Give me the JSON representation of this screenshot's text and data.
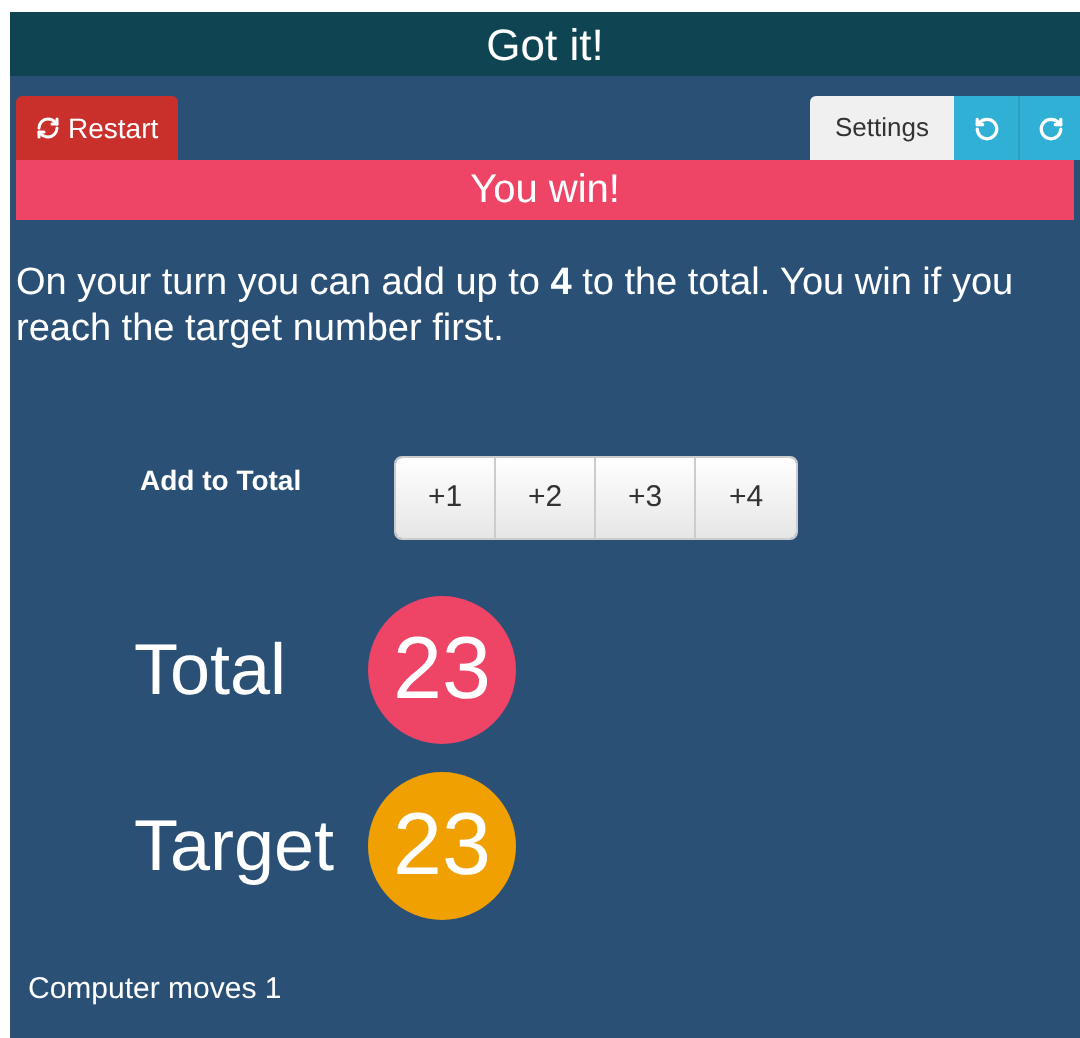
{
  "header": {
    "title": "Got it!"
  },
  "toolbar": {
    "restart": "Restart",
    "settings": "Settings"
  },
  "banner": {
    "text": "You win!"
  },
  "instructions": "On your turn you can add up to **4** to the total. You win if you reach the target number first.",
  "add": {
    "label": "Add to Total",
    "buttons": [
      "+1",
      "+2",
      "+3",
      "+4"
    ]
  },
  "total": {
    "label": "Total",
    "value": "23"
  },
  "target": {
    "label": "Target",
    "value": "23"
  },
  "status": "Computer moves 1"
}
